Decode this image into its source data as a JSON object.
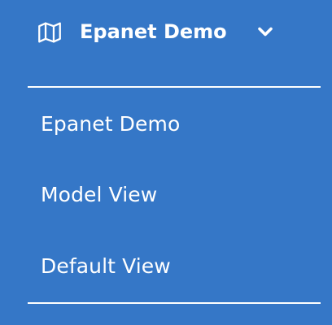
{
  "header": {
    "icon": "map-icon",
    "title": "Epanet Demo",
    "toggle_icon": "chevron-down-icon"
  },
  "menu": {
    "items": [
      {
        "label": "Epanet Demo"
      },
      {
        "label": "Model View"
      },
      {
        "label": "Default View"
      }
    ]
  },
  "colors": {
    "background": "#3577c7",
    "text": "#ffffff",
    "divider": "#ffffff"
  }
}
